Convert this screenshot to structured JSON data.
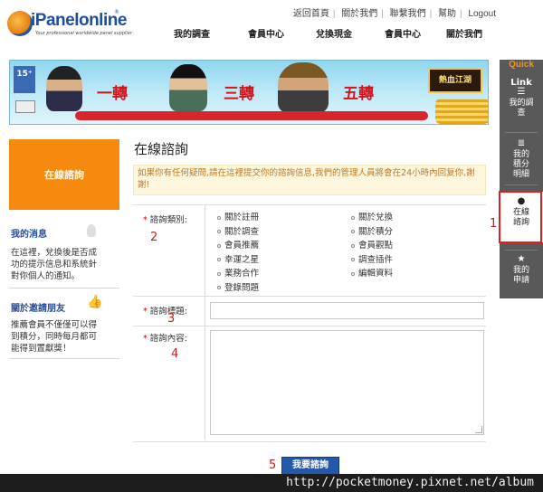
{
  "brand": {
    "name": "iPanelonline",
    "reg": "®",
    "tagline": "Your professional worldwide panel supplier"
  },
  "top_links": [
    "返回首頁",
    "關於我們",
    "聯繫我們",
    "幫助",
    "Logout"
  ],
  "main_nav": [
    "我的調查",
    "會員中心",
    "兌換現金",
    "會員中心",
    "關於我們"
  ],
  "banner": {
    "age": "15⁺",
    "t1": "一轉",
    "t2": "三轉",
    "t3": "五轉",
    "game": "熱血江湖"
  },
  "quick": {
    "title": "Quick",
    "link_label": "Link",
    "items": [
      {
        "icon": "list-icon",
        "glyph": "☰",
        "label": "我的調查"
      },
      {
        "icon": "database-icon",
        "glyph": "≣",
        "label": "我的積分明細"
      },
      {
        "icon": "chat-icon",
        "glyph": "●",
        "label": "在線諮詢"
      },
      {
        "icon": "star-icon",
        "glyph": "★",
        "label": "我的申請"
      }
    ]
  },
  "side": {
    "online_btn": "在線諮詢",
    "msg_title": "我的消息",
    "msg_text": "在這裡，兌換後是否成功的提示信息和系統針對你個人的通知。",
    "invite_title": "關於邀請朋友",
    "invite_text": "推薦會員不僅僅可以得到積分，同時每月都可能得到置獻獎！"
  },
  "form": {
    "title": "在線諮詢",
    "notice": "如果你有任何疑問,請在這裡提交你的諮詢信息,我們的管理人員將會在24小時內回复你,謝謝!",
    "req_mark": "*",
    "category_label": "諮詢類別:",
    "categories_left": [
      "關於註冊",
      "關於調查",
      "會員推薦",
      "幸運之星",
      "業務合作",
      "登錄問題"
    ],
    "categories_right": [
      "關於兌換",
      "關於積分",
      "會員觀點",
      "調查插件",
      "編輯資料"
    ],
    "subject_label": "諮詢標題:",
    "content_label": "諮詢內容:",
    "submit": "我要諮詢"
  },
  "annotations": [
    "1",
    "2",
    "3",
    "4",
    "5"
  ],
  "footer": {
    "url": "http://pocketmoney.pixnet.net/album"
  },
  "colors": {
    "accent_orange": "#f68a0f",
    "link_blue": "#2a4e9a",
    "submit_blue": "#2458a8",
    "highlight_red": "#e02020"
  }
}
